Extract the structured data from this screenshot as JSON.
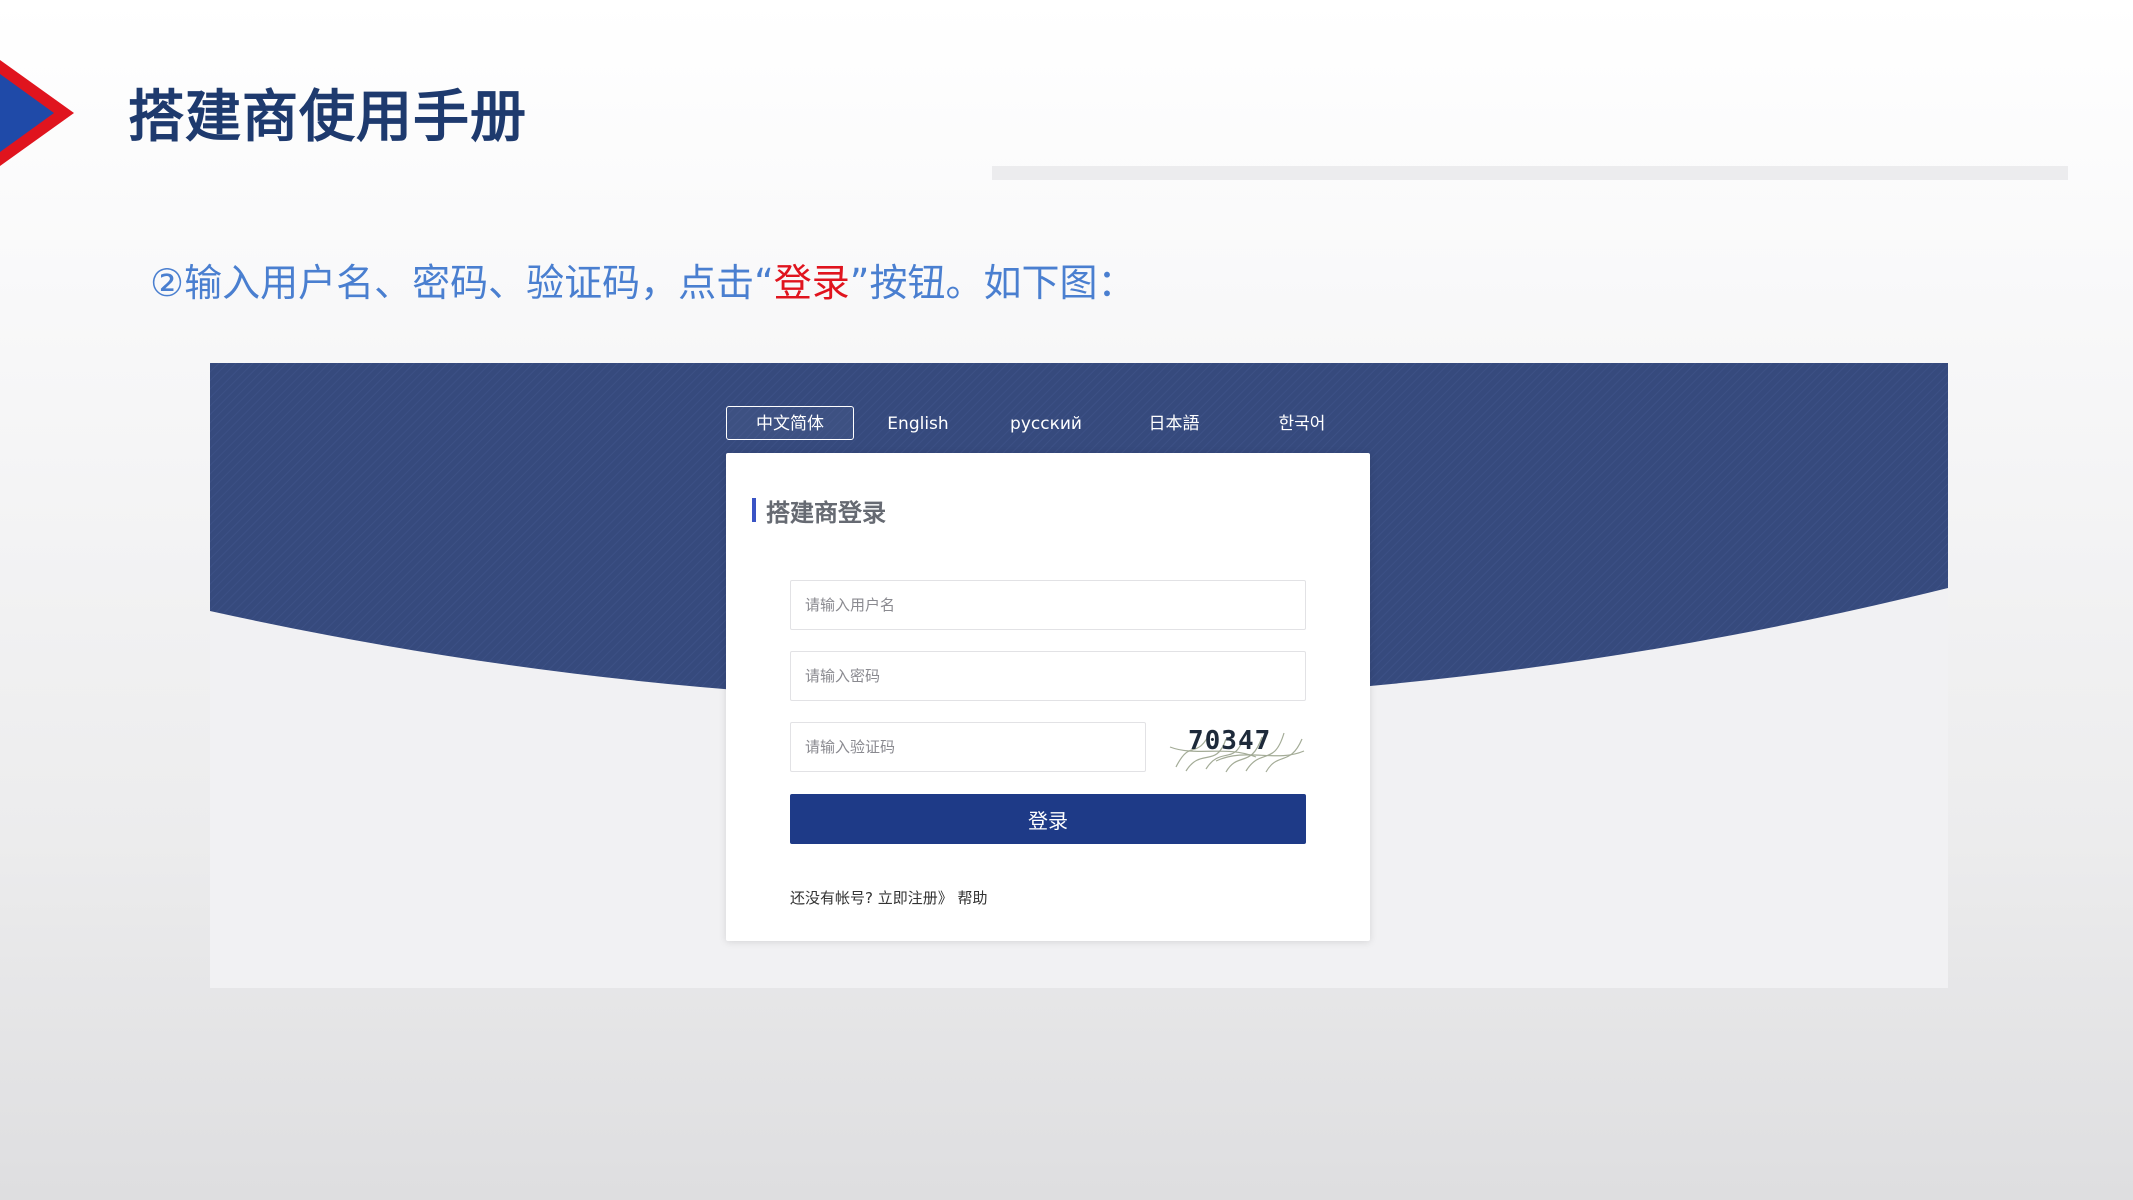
{
  "slide": {
    "title": "搭建商使用手册",
    "instruction_before": "②输入用户名、密码、验证码，点击“",
    "instruction_highlight": "登录",
    "instruction_after": "”按钮。如下图：",
    "colors": {
      "title": "#1e3a6e",
      "instruction": "#4a7fd0",
      "highlight": "#e0141e",
      "arrow_blue": "#1f4aa8",
      "arrow_red": "#e0141e"
    }
  },
  "login_page": {
    "languages": [
      {
        "label": "中文简体",
        "active": true
      },
      {
        "label": "English",
        "active": false
      },
      {
        "label": "русский",
        "active": false
      },
      {
        "label": "日本語",
        "active": false
      },
      {
        "label": "한국어",
        "active": false
      }
    ],
    "card_title": "搭建商登录",
    "username_placeholder": "请输入用户名",
    "password_placeholder": "请输入密码",
    "captcha_placeholder": "请输入验证码",
    "captcha_text": "70347",
    "login_button": "登录",
    "footer": {
      "no_account": "还没有帐号?",
      "register": "立即注册》",
      "help": "帮助"
    },
    "colors": {
      "banner": "#364a7d",
      "button": "#1e3a87",
      "title_bar": "#3a54c5"
    }
  }
}
